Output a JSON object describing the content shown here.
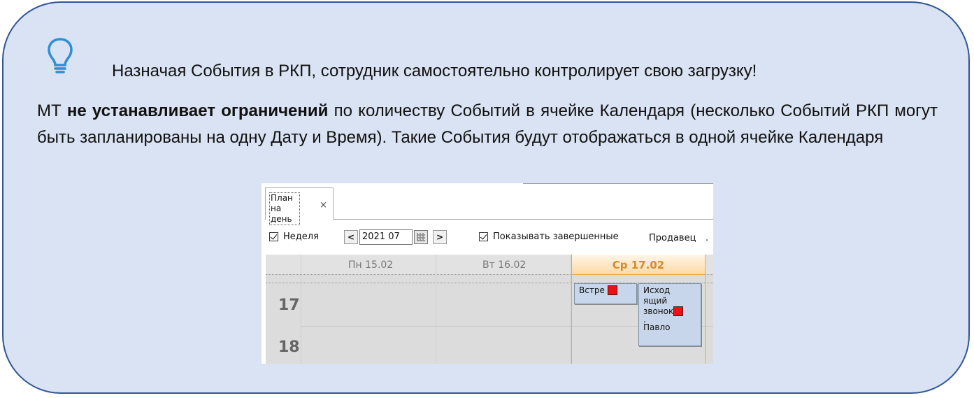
{
  "callout": {
    "icon": "lightbulb-icon",
    "headline": "Назначая События в РКП, сотрудник самостоятельно контролирует свою загрузку!",
    "body_prefix": "МТ ",
    "body_bold": "не устанавливает ограничений",
    "body_suffix": " по количеству Событий в ячейке Календаря (несколько Событий РКП могут быть запланированы на одну Дату и Время). Такие События будут отображаться в одной ячейке Календаря"
  },
  "screenshot": {
    "tab": {
      "label": "План на день",
      "close": "×"
    },
    "toolbar": {
      "week_checkbox_label": "Неделя",
      "week_checked": true,
      "prev_button": "<",
      "date_value": "2021  07",
      "next_button": ">",
      "show_completed_label": "Показывать завершенные",
      "show_completed_checked": true,
      "seller_label": "Продавец",
      "trailing": "."
    },
    "calendar": {
      "days": [
        {
          "label": "Пн 15.02",
          "today": false
        },
        {
          "label": "Вт 16.02",
          "today": false
        },
        {
          "label": "Ср 17.02",
          "today": true
        }
      ],
      "hours": [
        "17",
        "18"
      ],
      "events": [
        {
          "text": "Встре",
          "has_flag": true
        },
        {
          "lines": [
            "Исход",
            "ящий",
            "звонок",
            ".",
            "Павло"
          ],
          "has_flag": true
        }
      ]
    },
    "colors": {
      "today_accent": "#d58a2d",
      "event_bg": "#c7d6ea",
      "flag": "#ee1111"
    }
  }
}
